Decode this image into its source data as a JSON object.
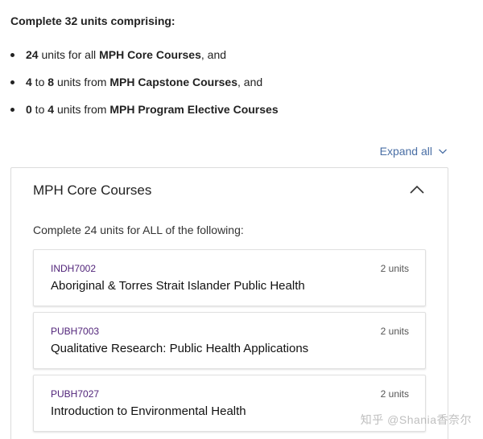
{
  "intro": "Complete 32 units comprising:",
  "requirements": [
    {
      "num1": "24",
      "mid": " units for all ",
      "group": "MPH Core Courses",
      "tail": ", and"
    },
    {
      "num1": "4",
      "to": " to ",
      "num2": "8",
      "mid": " units from ",
      "group": "MPH Capstone Courses",
      "tail": ", and"
    },
    {
      "num1": "0",
      "to": " to ",
      "num2": "4",
      "mid": " units from ",
      "group": "MPH Program Elective Courses",
      "tail": ""
    }
  ],
  "expand_all": "Expand all",
  "panel": {
    "title": "MPH Core Courses",
    "subtitle": "Complete 24 units for ALL of the following:",
    "courses": [
      {
        "code": "INDH7002",
        "units": "2 units",
        "name": "Aboriginal & Torres Strait Islander Public Health"
      },
      {
        "code": "PUBH7003",
        "units": "2 units",
        "name": "Qualitative Research: Public Health Applications"
      },
      {
        "code": "PUBH7027",
        "units": "2 units",
        "name": "Introduction to Environmental Health"
      }
    ]
  },
  "watermark": "知乎 @Shania香奈尔",
  "colors": {
    "course_code": "#51247a",
    "link": "#4a6fa5",
    "border": "#dcdcdc"
  },
  "icons": {
    "expand": "chevron-down-icon",
    "collapse": "chevron-up-icon"
  }
}
